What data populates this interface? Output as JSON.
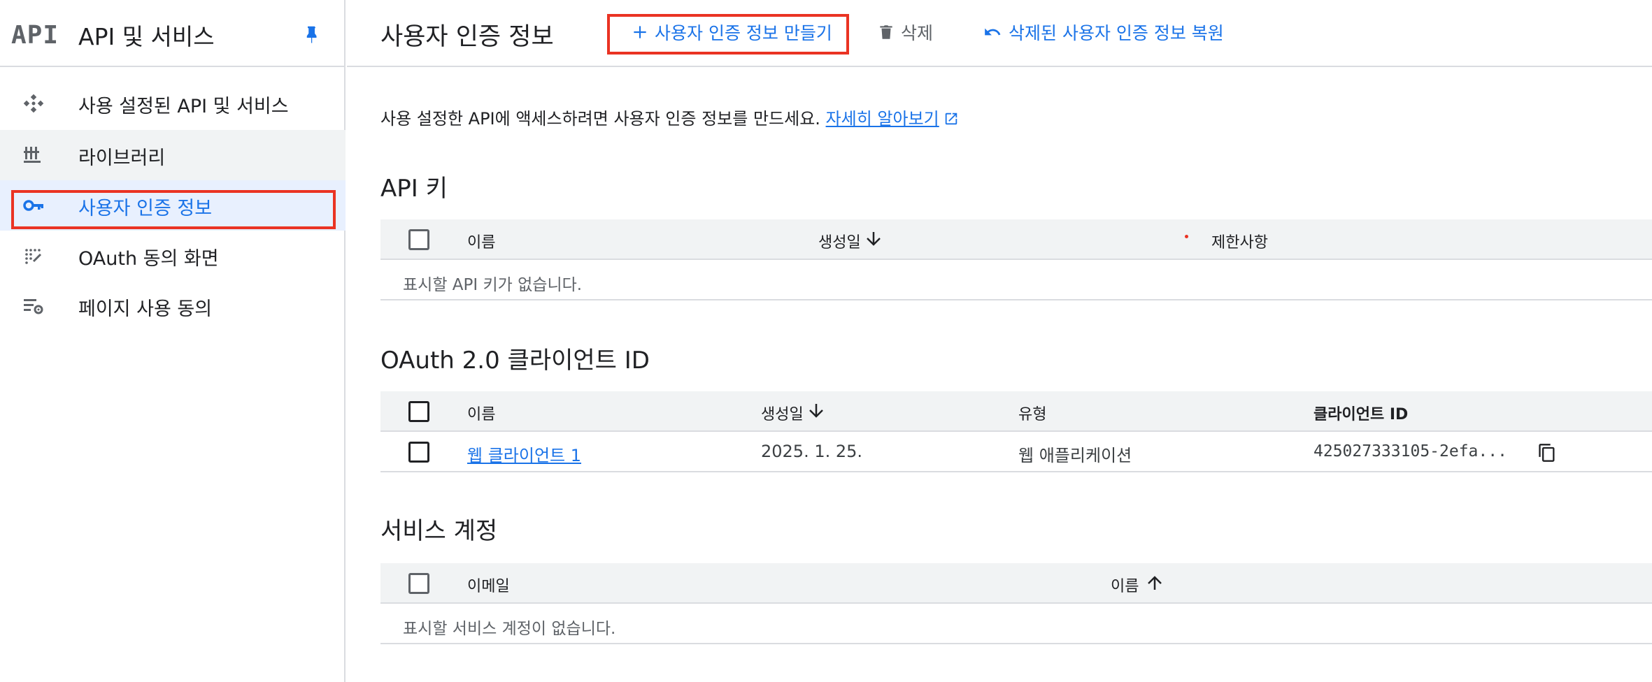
{
  "sidebar": {
    "logo": "API",
    "title": "API 및 서비스",
    "items": [
      {
        "label": "사용 설정된 API 및 서비스"
      },
      {
        "label": "라이브러리"
      },
      {
        "label": "사용자 인증 정보"
      },
      {
        "label": "OAuth 동의 화면"
      },
      {
        "label": "페이지 사용 동의"
      }
    ]
  },
  "toolbar": {
    "page_title": "사용자 인증 정보",
    "create_label": "사용자 인증 정보 만들기",
    "delete_label": "삭제",
    "restore_label": "삭제된 사용자 인증 정보 복원"
  },
  "intro": {
    "text": "사용 설정한 API에 액세스하려면 사용자 인증 정보를 만드세요.",
    "link": "자세히 알아보기"
  },
  "api_keys": {
    "title": "API 키",
    "columns": [
      "이름",
      "생성일",
      "제한사항"
    ],
    "empty": "표시할 API 키가 없습니다."
  },
  "oauth": {
    "title": "OAuth 2.0 클라이언트 ID",
    "columns": [
      "이름",
      "생성일",
      "유형",
      "클라이언트 ID"
    ],
    "rows": [
      {
        "name": "웹 클라이언트 1",
        "created": "2025. 1. 25.",
        "type": "웹 애플리케이션",
        "client_id": "425027333105-2efa..."
      }
    ]
  },
  "service_accounts": {
    "title": "서비스 계정",
    "columns": [
      "이메일",
      "이름"
    ],
    "empty": "표시할 서비스 계정이 없습니다."
  },
  "colors": {
    "accent": "#1a73e8",
    "highlight_outline": "#ea3323",
    "active_bg": "#e8f0fe",
    "hover_bg": "#f1f3f4"
  },
  "icons": {
    "pin": "pin-icon",
    "enabled_apis": "enabled-apis-icon",
    "library": "library-icon",
    "credentials": "key-icon",
    "oauth_consent": "oauth-consent-icon",
    "page_consent": "page-consent-icon",
    "add": "plus-icon",
    "delete": "trash-icon",
    "restore": "undo-icon",
    "external_link": "external-link-icon",
    "sort_down": "arrow-down-icon",
    "sort_up": "arrow-up-icon",
    "copy": "copy-icon"
  }
}
